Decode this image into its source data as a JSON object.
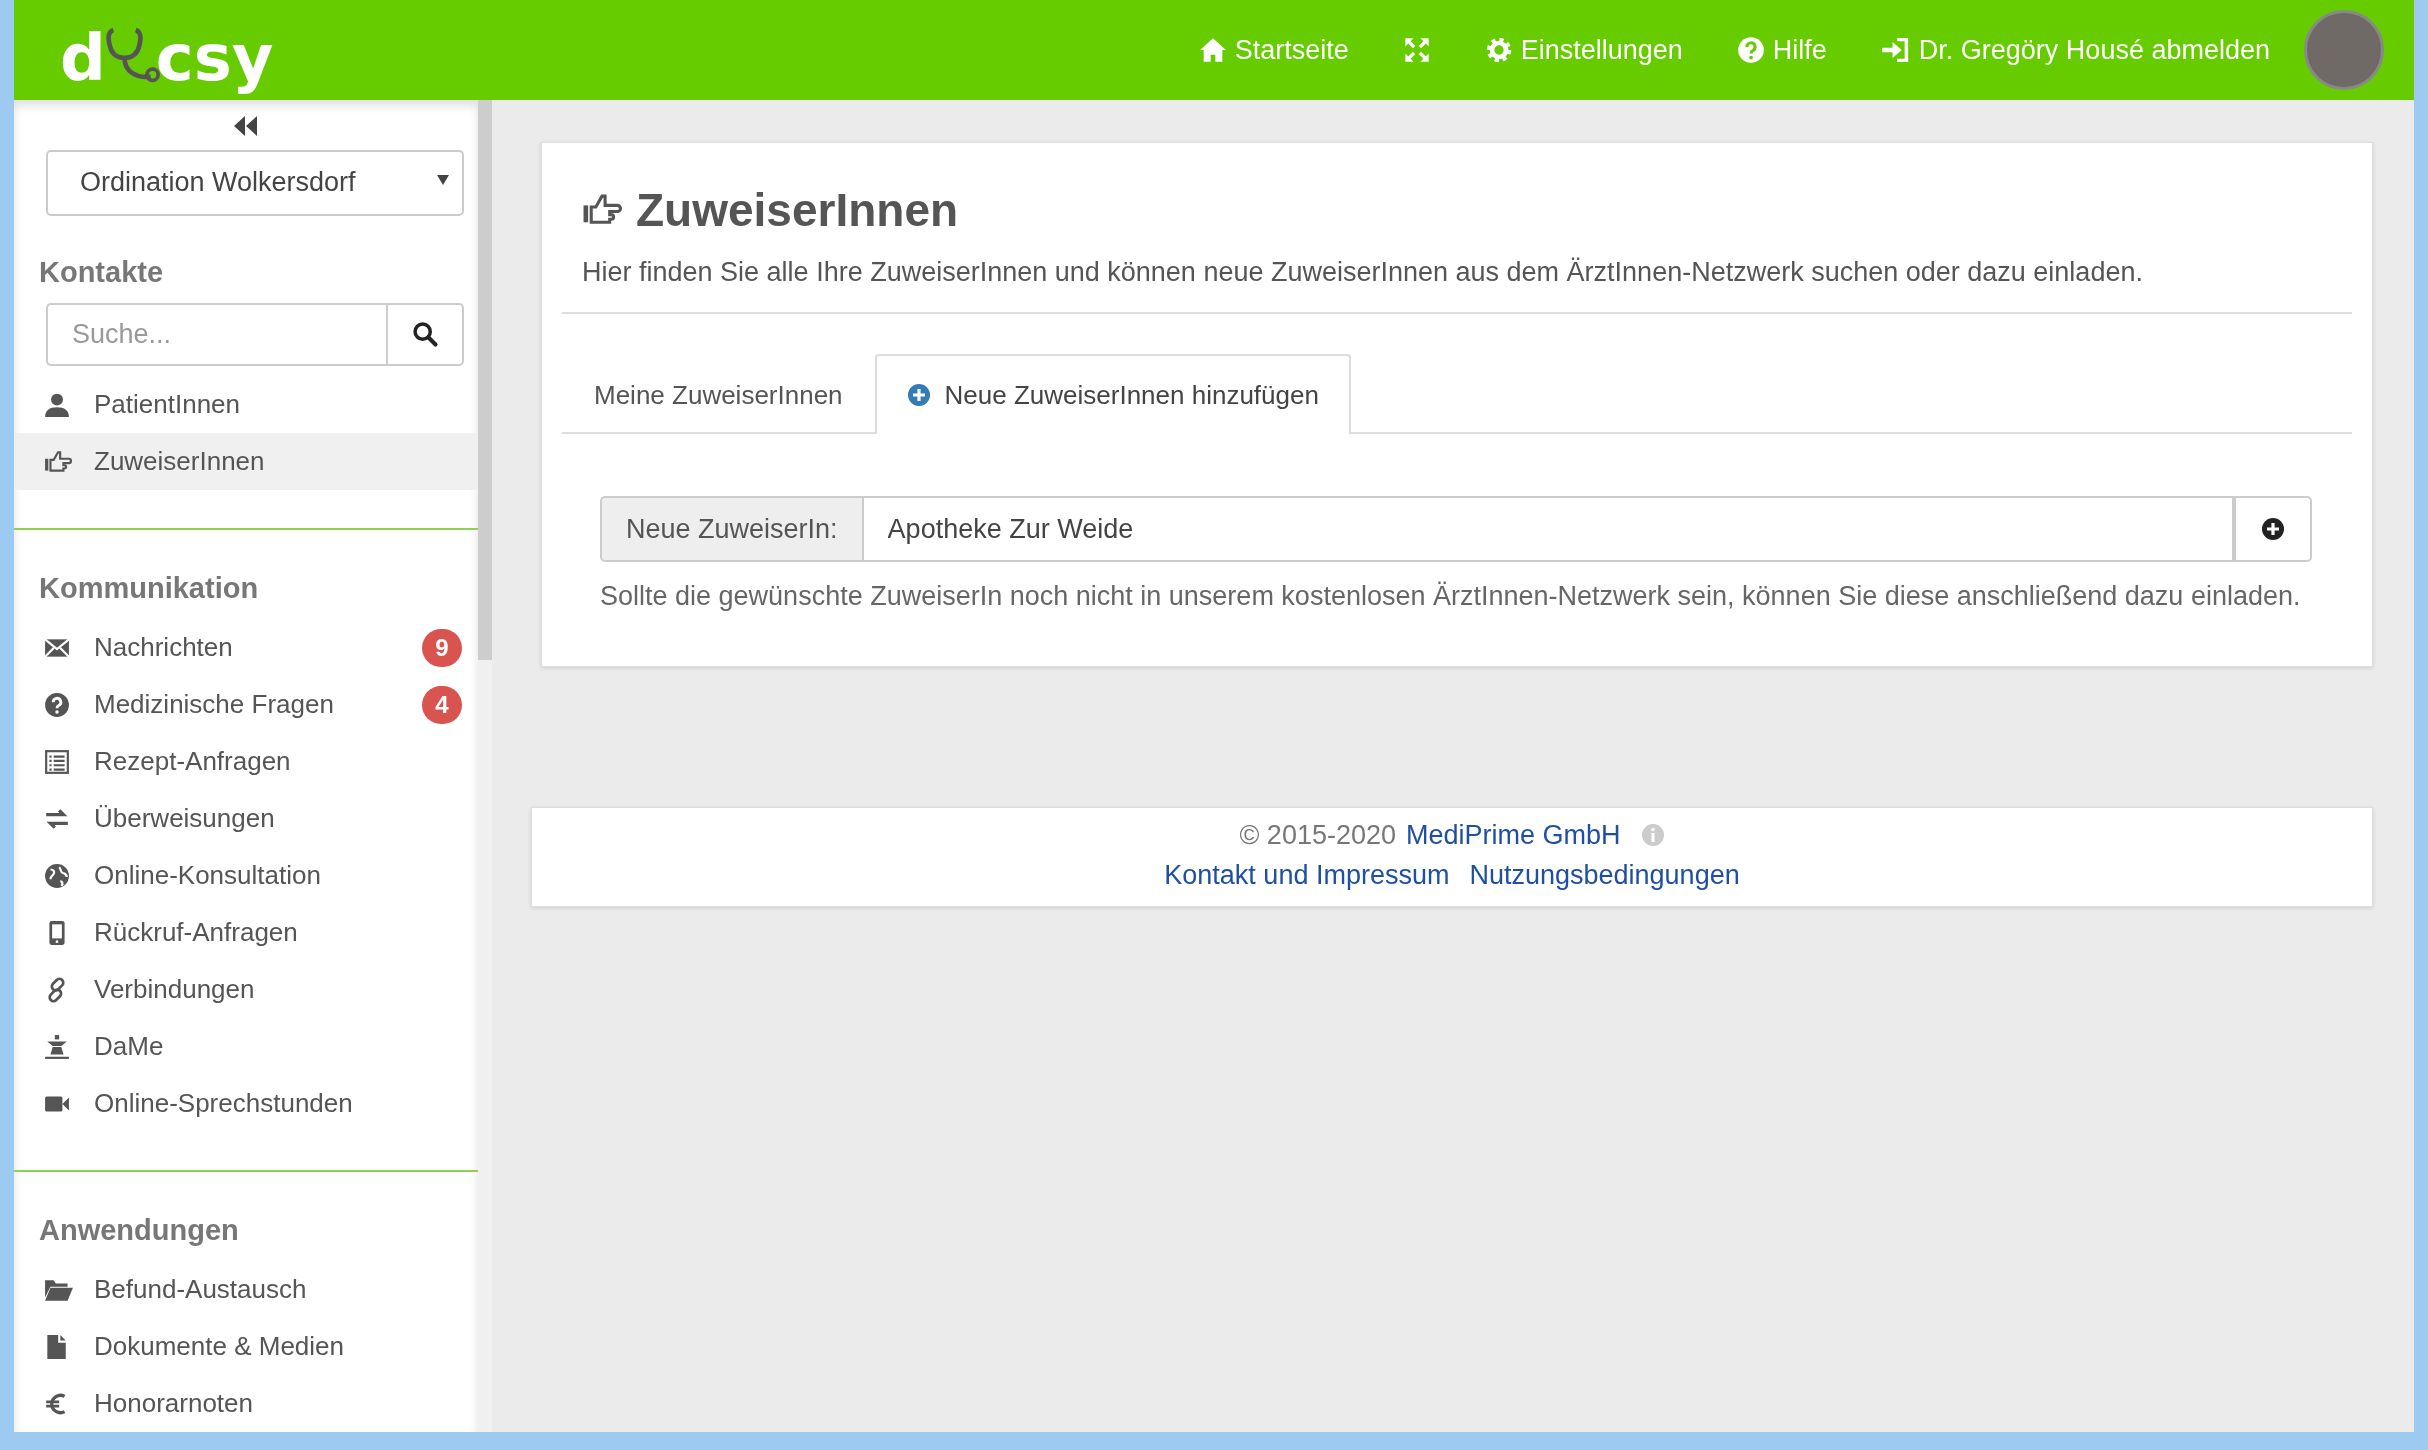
{
  "header": {
    "logo": {
      "left": "d",
      "right": "csy"
    },
    "nav": [
      {
        "kind": "home",
        "label": "Startseite"
      },
      {
        "kind": "fullscreen"
      },
      {
        "kind": "settings",
        "label": "Einstellungen"
      },
      {
        "kind": "help",
        "label": "Hilfe"
      },
      {
        "kind": "logout",
        "label": "Dr. Gregöry Housé abmelden"
      }
    ]
  },
  "sidebar": {
    "practice_select": {
      "value": "Ordination Wolkersdorf"
    },
    "sections": [
      {
        "title": "Kontakte",
        "search": {
          "placeholder": "Suche..."
        },
        "items": [
          {
            "label": "PatientInnen",
            "selected": false
          },
          {
            "label": "ZuweiserInnen",
            "selected": true
          }
        ]
      },
      {
        "title": "Kommunikation",
        "items": [
          {
            "label": "Nachrichten",
            "selected": false,
            "badge": "9"
          },
          {
            "label": "Medizinische Fragen",
            "selected": false,
            "badge": "4"
          },
          {
            "label": "Rezept-Anfragen",
            "selected": false
          },
          {
            "label": "Überweisungen",
            "selected": false
          },
          {
            "label": "Online-Konsultation",
            "selected": false
          },
          {
            "label": "Rückruf-Anfragen",
            "selected": false
          },
          {
            "label": "Verbindungen",
            "selected": false
          },
          {
            "label": "DaMe",
            "selected": false
          },
          {
            "label": "Online-Sprechstunden",
            "selected": false
          }
        ]
      },
      {
        "title": "Anwendungen",
        "items": [
          {
            "label": "Befund-Austausch",
            "selected": false
          },
          {
            "label": "Dokumente & Medien",
            "selected": false
          },
          {
            "label": "Honorarnoten",
            "selected": false
          }
        ]
      }
    ]
  },
  "page": {
    "title": "ZuweiserInnen",
    "description": "Hier finden Sie alle Ihre ZuweiserInnen und können neue ZuweiserInnen aus dem ÄrztInnen-Netzwerk suchen oder dazu einladen.",
    "tabs": [
      {
        "label": "Meine ZuweiserInnen",
        "selected": false,
        "kind": "plain"
      },
      {
        "label": "Neue ZuweiserInnen hinzufügen",
        "selected": true,
        "kind": "add"
      }
    ],
    "field": {
      "label": "Neue ZuweiserIn:",
      "value": "Apotheke Zur Weide"
    },
    "hint": "Sollte die gewünschte ZuweiserIn noch nicht in unserem kostenlosen ÄrztInnen-Netzwerk sein, können Sie diese anschließend dazu einladen."
  },
  "footer": {
    "copyright": "© 2015-2020",
    "company": "MediPrime GmbH",
    "links": [
      "Kontakt und Impressum",
      "Nutzungsbedingungen"
    ]
  }
}
